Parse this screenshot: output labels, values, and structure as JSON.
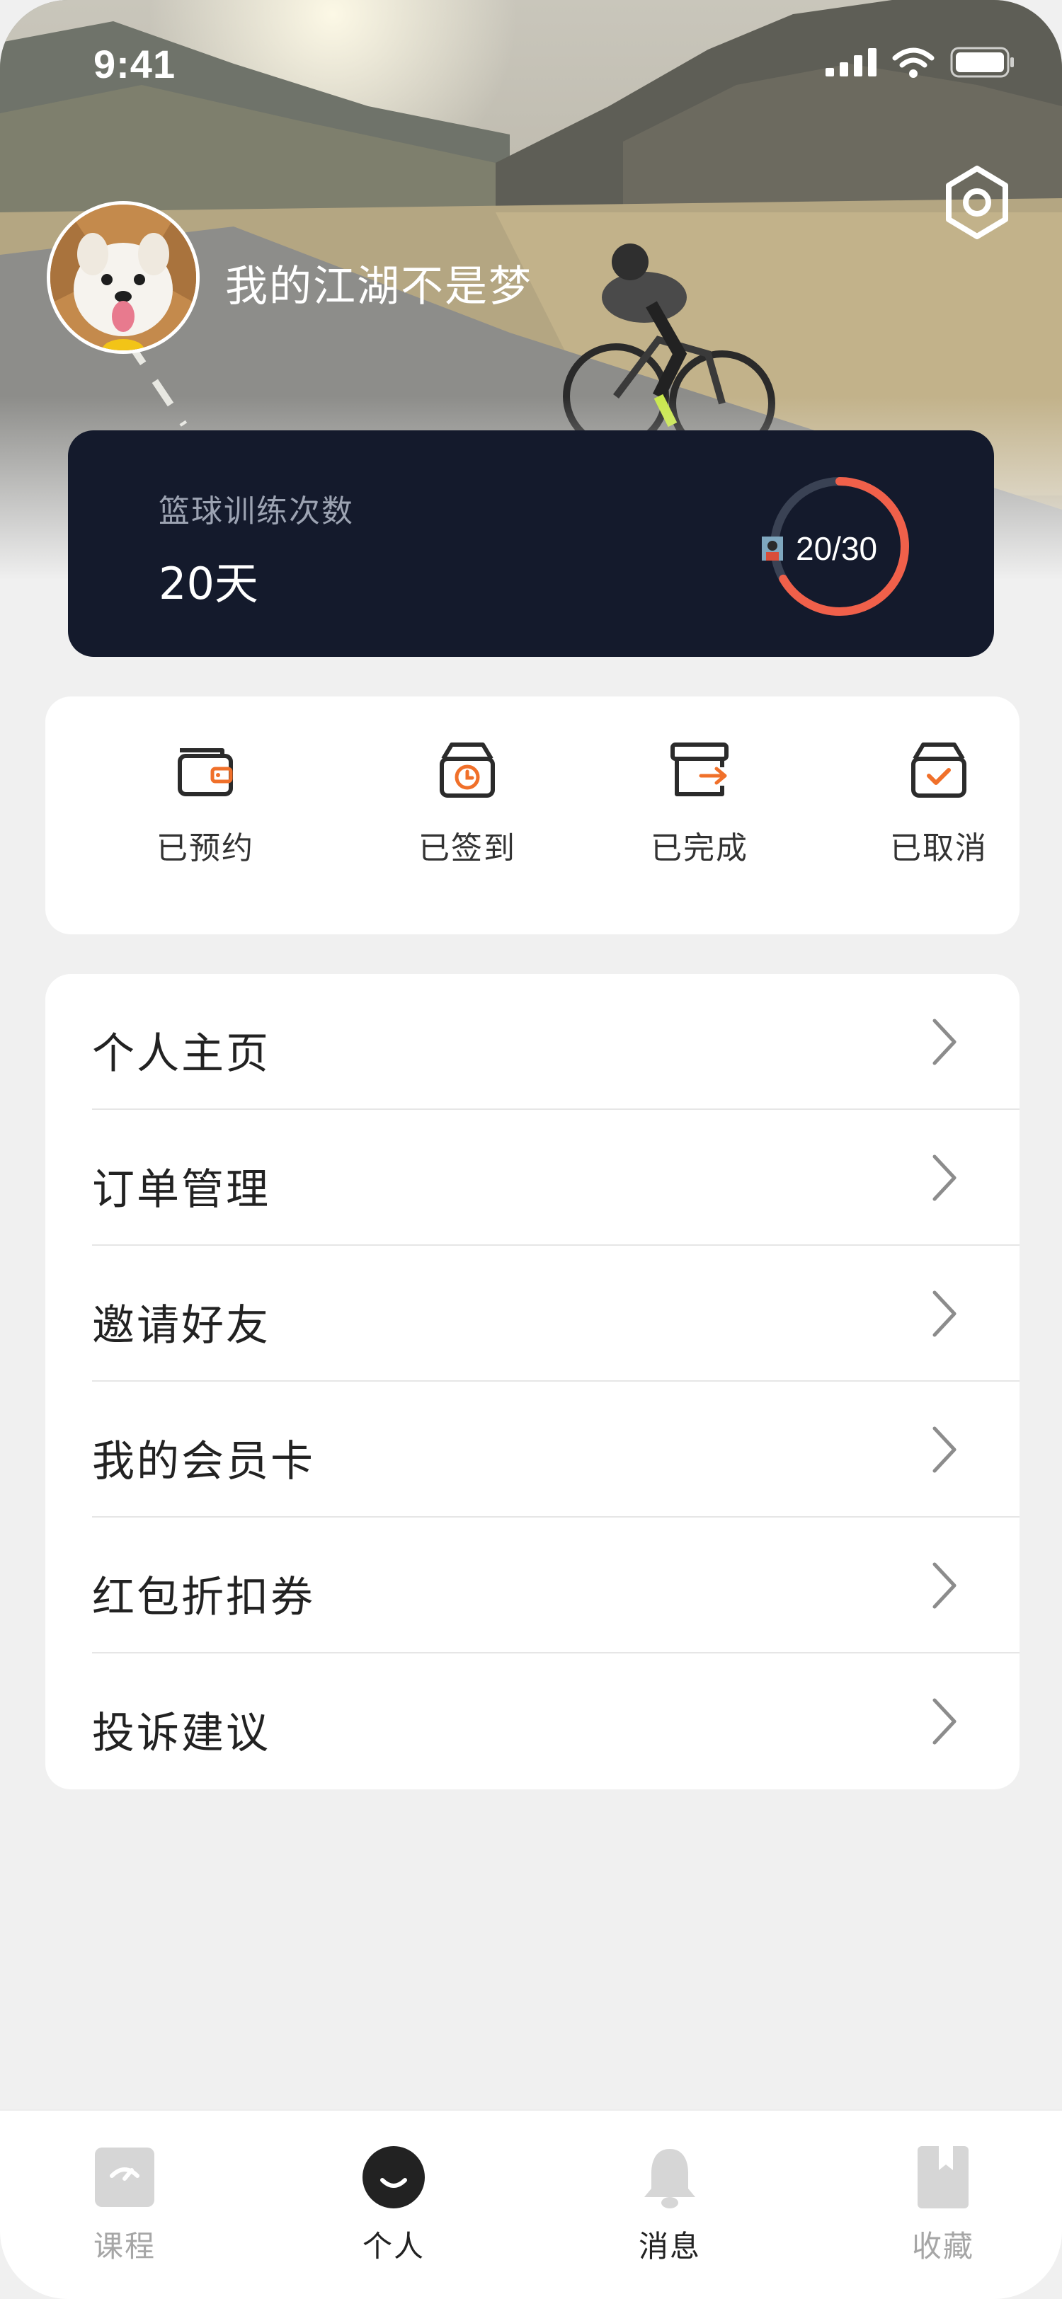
{
  "status_bar": {
    "time": "9:41",
    "icons": [
      "signal-icon",
      "wifi-icon",
      "battery-icon"
    ]
  },
  "header": {
    "settings_icon": "settings-hexagon-icon",
    "username": "我的江湖不是梦"
  },
  "training": {
    "label": "篮球训练次数",
    "days": "20天",
    "progress_text": "20/30",
    "progress_value": 20,
    "progress_total": 30,
    "ring_color": "#f0604a",
    "ring_track_color": "#3a4254"
  },
  "order_status": [
    {
      "label": "已预约",
      "icon": "wallet-icon"
    },
    {
      "label": "已签到",
      "icon": "box-clock-icon"
    },
    {
      "label": "已完成",
      "icon": "box-arrow-icon"
    },
    {
      "label": "已取消",
      "icon": "box-check-icon"
    }
  ],
  "menu": [
    {
      "label": "个人主页"
    },
    {
      "label": "订单管理"
    },
    {
      "label": "邀请好友"
    },
    {
      "label": "我的会员卡"
    },
    {
      "label": "红包折扣券"
    },
    {
      "label": "投诉建议"
    }
  ],
  "tabs": [
    {
      "label": "课程",
      "icon": "course-icon",
      "active": false
    },
    {
      "label": "个人",
      "icon": "profile-icon",
      "active": true
    },
    {
      "label": "消息",
      "icon": "bell-icon",
      "active": false
    },
    {
      "label": "收藏",
      "icon": "bookmark-icon",
      "active": false
    }
  ],
  "colors": {
    "accent": "#f0702a",
    "card_dark": "#141a2c",
    "tab_active": "#222222",
    "tab_inactive": "#a6a6a6"
  }
}
